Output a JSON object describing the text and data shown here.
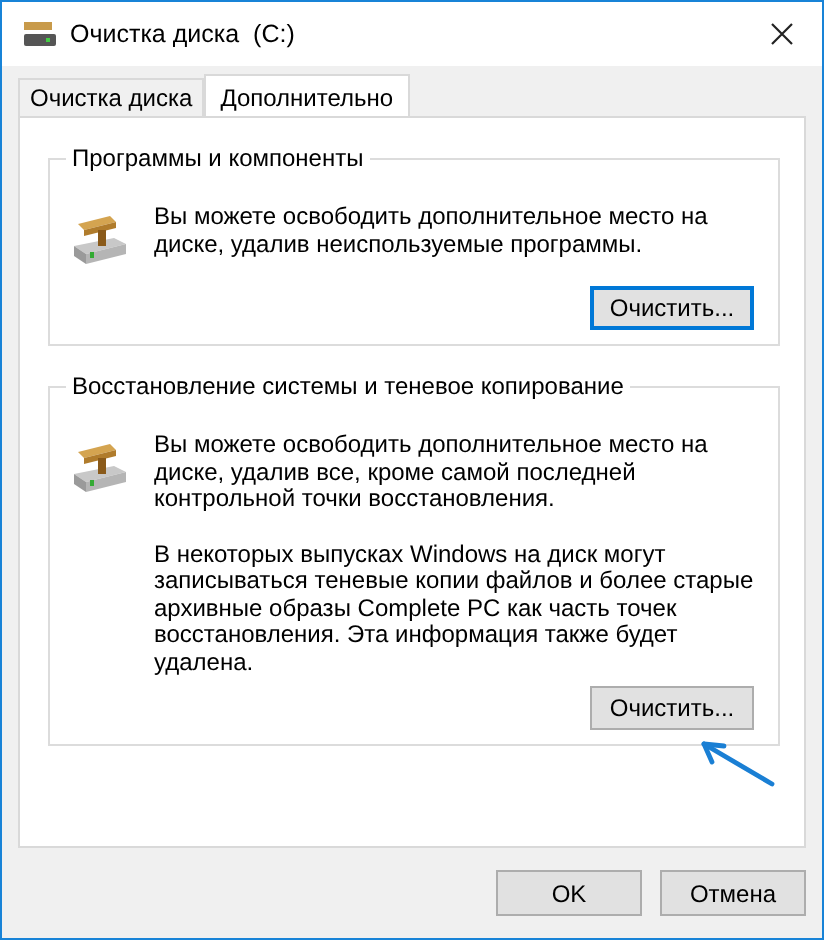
{
  "window": {
    "title": "Очистка диска  (C:)"
  },
  "tabs": [
    {
      "label": "Очистка диска",
      "selected": false
    },
    {
      "label": "Дополнительно",
      "selected": true
    }
  ],
  "groups": [
    {
      "title": "Программы и компоненты",
      "paragraphs": [
        "Вы можете освободить дополнительное место на диске, удалив неиспользуемые программы."
      ],
      "button": {
        "label": "Очистить...",
        "focused": true
      }
    },
    {
      "title": "Восстановление системы и теневое копирование",
      "paragraphs": [
        "Вы можете освободить дополнительное место на диске, удалив все, кроме самой последней контрольной точки восстановления.",
        "В некоторых выпусках Windows на диск могут записываться теневые копии файлов и более старые архивные образы Complete PC как часть точек восстановления. Эта информация также будет удалена."
      ],
      "button": {
        "label": "Очистить...",
        "focused": false
      }
    }
  ],
  "buttons": [
    "OK",
    "Отмена"
  ]
}
